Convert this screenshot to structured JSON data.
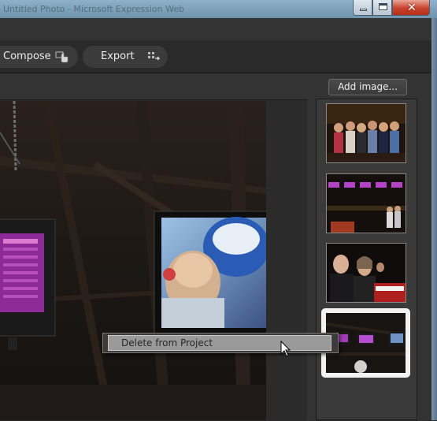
{
  "window": {
    "title": "Untitled Photo - Microsoft Expression Web",
    "close_glyph": "✕"
  },
  "toolbar": {
    "compose_label": "Compose",
    "export_label": "Export",
    "compose_icon": "hand-pointer-icon",
    "export_icon": "export-grid-icon"
  },
  "filmstrip": {
    "add_image_label": "Add image...",
    "thumbnails": [
      {
        "name": "group-of-friends-photo"
      },
      {
        "name": "bowling-alley-lanes-photo"
      },
      {
        "name": "couple-portrait-photo"
      },
      {
        "name": "bowling-alley-dark-photo",
        "selected": true
      }
    ]
  },
  "context_menu": {
    "items": [
      "Delete from Project"
    ]
  },
  "colors": {
    "background": "#2d2d2d",
    "accent_selected": "#f2f2f2",
    "menu_highlight": "#9a9a9a"
  }
}
